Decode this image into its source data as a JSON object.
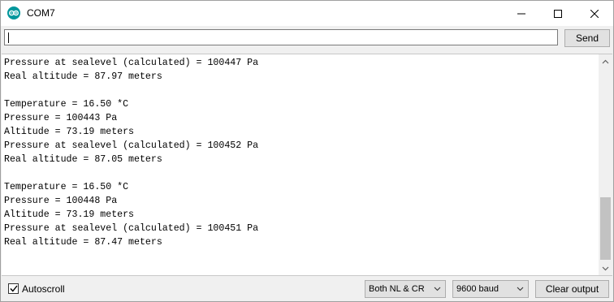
{
  "window": {
    "title": "COM7"
  },
  "send_bar": {
    "input_value": "",
    "send_label": "Send"
  },
  "output": {
    "lines": [
      "Pressure at sealevel (calculated) = 100447 Pa",
      "Real altitude = 87.97 meters",
      "",
      "Temperature = 16.50 *C",
      "Pressure = 100443 Pa",
      "Altitude = 73.19 meters",
      "Pressure at sealevel (calculated) = 100452 Pa",
      "Real altitude = 87.05 meters",
      "",
      "Temperature = 16.50 *C",
      "Pressure = 100448 Pa",
      "Altitude = 73.19 meters",
      "Pressure at sealevel (calculated) = 100451 Pa",
      "Real altitude = 87.47 meters"
    ]
  },
  "footer": {
    "autoscroll_label": "Autoscroll",
    "autoscroll_checked": true,
    "line_ending": "Both NL & CR",
    "baud_rate": "9600 baud",
    "clear_label": "Clear output"
  },
  "icons": {
    "app": "arduino-icon",
    "minimize": "minimize-icon",
    "maximize": "maximize-icon",
    "close": "close-icon"
  },
  "colors": {
    "app_icon": "#00979c"
  }
}
